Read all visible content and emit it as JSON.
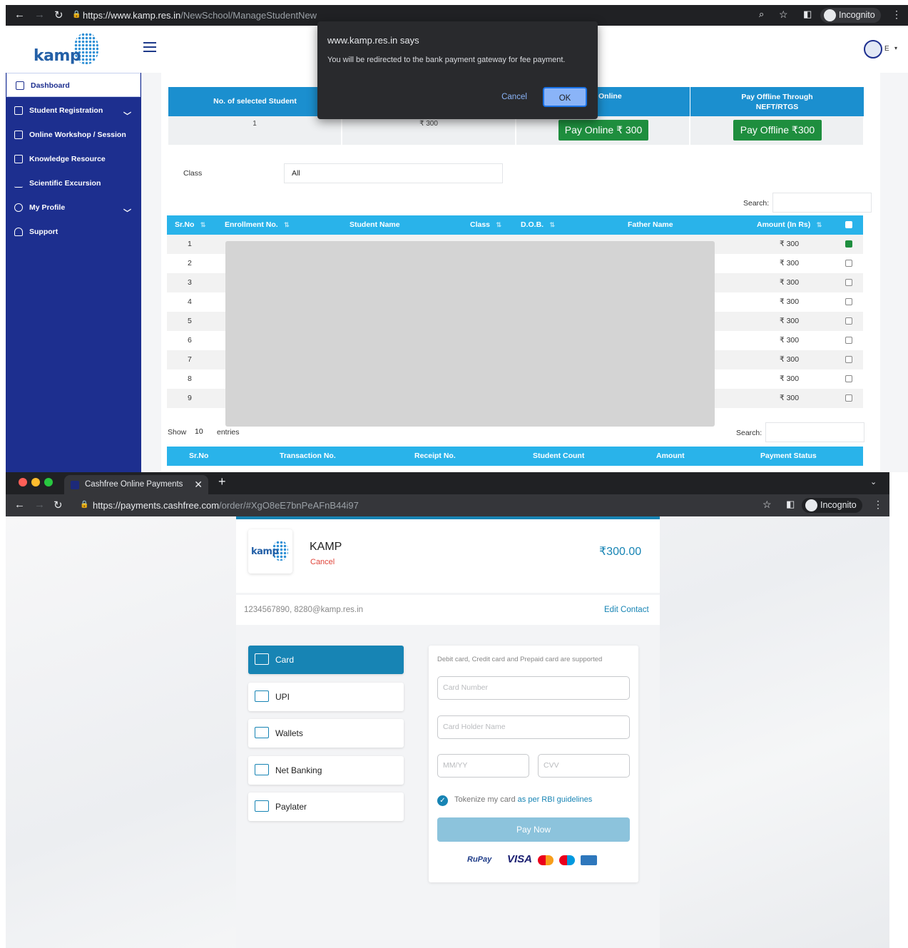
{
  "top_browser": {
    "url_domain": "https://www.kamp.res.in",
    "url_path": "/NewSchool/ManageStudentNew",
    "incognito_label": "Incognito",
    "logo_text": "kamp",
    "user_initial": "E",
    "sidebar": [
      {
        "label": "Dashboard",
        "icon": "dashboard-icon"
      },
      {
        "label": "Student Registration",
        "icon": "registration-icon",
        "has_chevron": true
      },
      {
        "label": "Online Workshop / Session",
        "icon": "workshop-icon"
      },
      {
        "label": "Knowledge Resource",
        "icon": "book-icon"
      },
      {
        "label": "Scientific Excursion",
        "icon": "chart-icon"
      },
      {
        "label": "My Profile",
        "icon": "user-icon",
        "has_chevron": true
      },
      {
        "label": "Support",
        "icon": "headset-icon"
      }
    ],
    "summary": {
      "col1": "No. of selected Student",
      "col3": "Online",
      "col4a": "Pay Offline Through",
      "col4b": "NEFT/RTGS",
      "count": "1",
      "amount": "₹ 300",
      "pay_online_label": "Pay Online  ₹ 300",
      "pay_offline_label": "Pay Offline  ₹300"
    },
    "filter": {
      "class_label": "Class",
      "class_value": "All",
      "search_label": "Search:"
    },
    "table_headers": [
      "Sr.No",
      "Enrollment No.",
      "Student Name",
      "Class",
      "D.O.B.",
      "Father Name",
      "Amount (In Rs)"
    ],
    "rows": [
      {
        "sr": "1",
        "amount": "₹ 300",
        "checked": true
      },
      {
        "sr": "2",
        "amount": "₹ 300",
        "checked": false
      },
      {
        "sr": "3",
        "amount": "₹ 300",
        "checked": false
      },
      {
        "sr": "4",
        "amount": "₹ 300",
        "checked": false
      },
      {
        "sr": "5",
        "amount": "₹ 300",
        "checked": false
      },
      {
        "sr": "6",
        "amount": "₹ 300",
        "checked": false
      },
      {
        "sr": "7",
        "amount": "₹ 300",
        "checked": false
      },
      {
        "sr": "8",
        "amount": "₹ 300",
        "checked": false
      },
      {
        "sr": "9",
        "amount": "₹ 300",
        "checked": false
      }
    ],
    "entries": {
      "show": "Show",
      "value": "10",
      "suffix": "entries",
      "search_label": "Search:"
    },
    "table2_headers": [
      "Sr.No",
      "Transaction No.",
      "Receipt No.",
      "Student Count",
      "Amount",
      "Payment Status"
    ],
    "dialog": {
      "title": "www.kamp.res.in says",
      "message": "You will be redirected to the bank payment gateway for fee payment.",
      "cancel": "Cancel",
      "ok": "OK"
    }
  },
  "bottom_browser": {
    "tab_title": "Cashfree Online Payments",
    "new_tab": "+",
    "url_domain": "https://payments.cashfree.com",
    "url_path": "/order/#XgO8eE7bnPeAFnB44i97",
    "incognito_label": "Incognito",
    "merchant_name": "KAMP",
    "cancel_label": "Cancel",
    "amount": "₹300.00",
    "contact": "1234567890, 8280@kamp.res.in",
    "edit_contact": "Edit Contact",
    "methods": [
      {
        "label": "Card",
        "icon": "card-icon",
        "selected": true
      },
      {
        "label": "UPI",
        "icon": "upi-icon",
        "selected": false
      },
      {
        "label": "Wallets",
        "icon": "wallet-icon",
        "selected": false
      },
      {
        "label": "Net Banking",
        "icon": "bank-icon",
        "selected": false
      },
      {
        "label": "Paylater",
        "icon": "clock-icon",
        "selected": false
      }
    ],
    "form": {
      "supported_note": "Debit card, Credit card and Prepaid card are supported",
      "card_number_ph": "Card Number",
      "holder_ph": "Card Holder Name",
      "expiry_ph": "MM/YY",
      "cvv_ph": "CVV",
      "tokenize_text": "Tokenize my card",
      "tokenize_link": "as per RBI guidelines",
      "pay_now": "Pay Now",
      "brands": [
        "RuPay",
        "VISA"
      ]
    }
  },
  "colors": {
    "sidebar": "#1d2f8f",
    "table_head": "#29b3ea",
    "pay_green": "#1e8e3e",
    "cashfree_blue": "#1784b4"
  }
}
